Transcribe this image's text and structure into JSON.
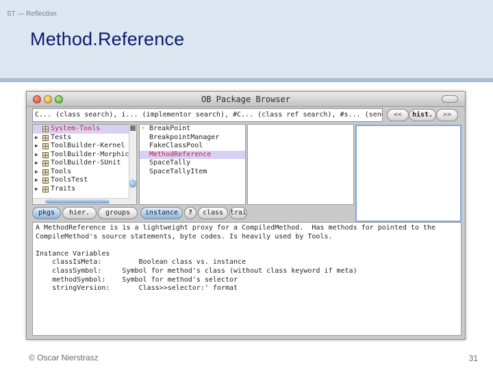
{
  "slide": {
    "breadcrumb": "ST — Reflection",
    "title": "Method.Reference",
    "footer_author": "© Oscar Nierstrasz",
    "page_number": "31"
  },
  "window": {
    "title": "OB Package Browser",
    "search_text": "C... (class search), i... (implementor search), #C... (class ref search), #s... (sender",
    "nav_back": "<<",
    "nav_hist": "hist.",
    "nav_forward": ">>"
  },
  "packages": [
    {
      "label": "System-Tools",
      "selected": true,
      "expand": false
    },
    {
      "label": "Tests",
      "selected": false,
      "expand": true
    },
    {
      "label": "ToolBuilder-Kernel",
      "selected": false,
      "expand": true
    },
    {
      "label": "ToolBuilder-Morphic",
      "selected": false,
      "expand": true
    },
    {
      "label": "ToolBuilder-SUnit",
      "selected": false,
      "expand": true
    },
    {
      "label": "Tools",
      "selected": false,
      "expand": true
    },
    {
      "label": "ToolsTest",
      "selected": false,
      "expand": true
    },
    {
      "label": "Traits",
      "selected": false,
      "expand": true
    }
  ],
  "classes": [
    {
      "label": "BreakPoint",
      "selected": false,
      "icon": true
    },
    {
      "label": "BreakpointManager",
      "selected": false,
      "icon": false
    },
    {
      "label": "FakeClassPool",
      "selected": false,
      "icon": false
    },
    {
      "label": "MethodReference",
      "selected": true,
      "icon": false
    },
    {
      "label": "SpaceTally",
      "selected": false,
      "icon": false
    },
    {
      "label": "SpaceTallyItem",
      "selected": false,
      "icon": false
    }
  ],
  "tabs": {
    "pkgs": "pkgs",
    "hier": "hier.",
    "groups": "groups",
    "instance": "instance",
    "help": "?",
    "class": "class",
    "traits": "trai"
  },
  "code_lines": [
    "A MethodReference is is a lightweight proxy for a CompiledMethod.  Has methods for pointed to the",
    "CompileMethod's source statements, byte codes. Is heavily used by Tools.",
    "",
    "Instance Variables",
    "    classIsMeta:         Boolean class vs. instance",
    "    classSymbol:     Symbol for method's class (without class keyword if meta)",
    "    methodSymbol:    Symbol for method's selector",
    "    stringVersion:       Class>>selector:' format"
  ]
}
